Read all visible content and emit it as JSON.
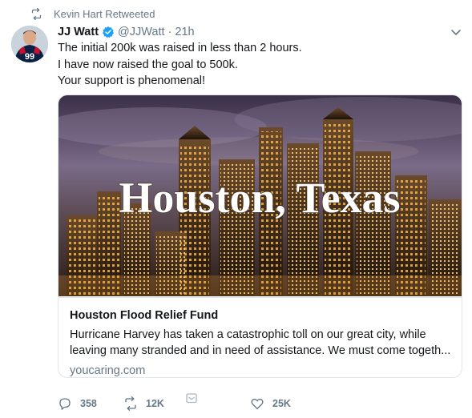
{
  "retweet_context": {
    "text": "Kevin Hart Retweeted",
    "icon": "retweet-icon"
  },
  "author": {
    "name": "JJ Watt",
    "handle": "@JJWatt",
    "separator": "·",
    "time": "21h",
    "verified": true,
    "avatar_jersey": "99"
  },
  "tweet": {
    "lines": [
      "The initial 200k was raised in less than 2 hours.",
      "I have now raised the goal to 500k.",
      "Your support is phenomenal!"
    ]
  },
  "card": {
    "image_overlay_text": "Houston, Texas",
    "title": "Houston Flood Relief Fund",
    "description_lines": [
      "Hurricane Harvey has taken a catastrophic toll on our great city, while",
      "leaving many stranded and in need of assistance. We must come togeth..."
    ],
    "domain": "youcaring.com"
  },
  "actions": {
    "reply_count": "358",
    "retweet_count": "12K",
    "like_count": "25K"
  },
  "colors": {
    "secondary_text": "#657786",
    "verified_blue": "#1da1f2",
    "border": "#e1e8ed"
  }
}
